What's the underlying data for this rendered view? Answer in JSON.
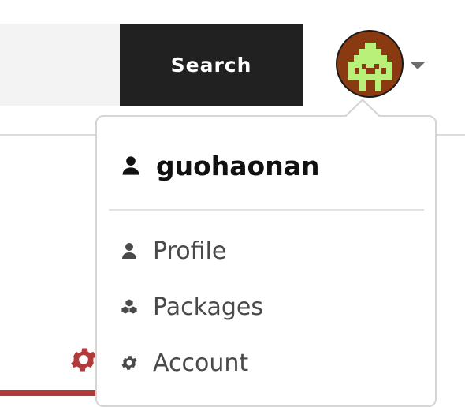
{
  "search": {
    "placeholder": "",
    "button_label": "Search"
  },
  "user_menu": {
    "username": "guohaonan",
    "items": [
      {
        "label": "Profile",
        "icon": "user-icon"
      },
      {
        "label": "Packages",
        "icon": "cubes-icon"
      },
      {
        "label": "Account",
        "icon": "gear-icon"
      }
    ]
  },
  "colors": {
    "search_button_bg": "#212121",
    "avatar_bg": "#8a3a10",
    "avatar_pixel": "#b8f07a",
    "accent_red": "#b23a3a"
  }
}
